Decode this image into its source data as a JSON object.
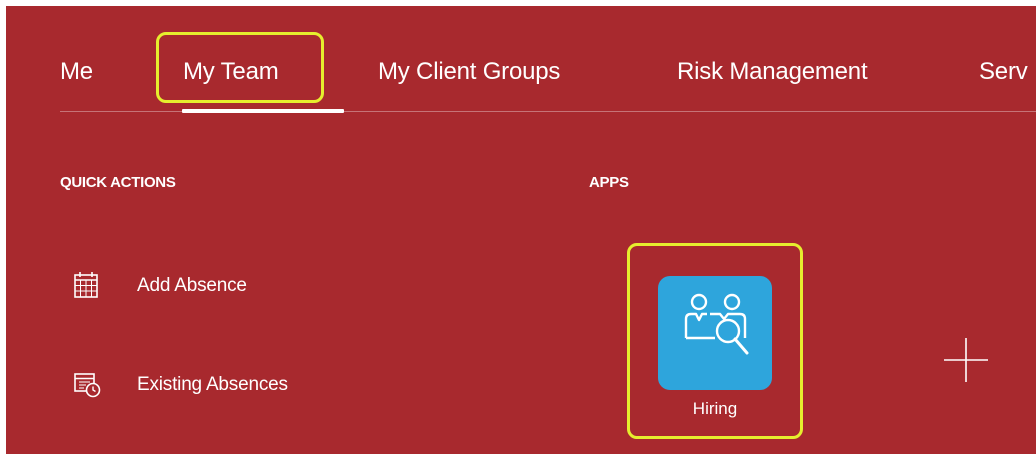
{
  "nav": {
    "tabs": [
      {
        "label": "Me"
      },
      {
        "label": "My Team"
      },
      {
        "label": "My Client Groups"
      },
      {
        "label": "Risk Management"
      },
      {
        "label": "Serv"
      }
    ],
    "active_tab": "My Team"
  },
  "quick_actions": {
    "title": "QUICK ACTIONS",
    "items": [
      {
        "label": "Add Absence",
        "icon": "calendar-icon"
      },
      {
        "label": "Existing Absences",
        "icon": "calendar-clock-icon"
      }
    ]
  },
  "apps": {
    "title": "APPS",
    "items": [
      {
        "label": "Hiring",
        "icon": "hiring-people-search-icon",
        "tile_color": "#2ea5dc"
      }
    ],
    "add_icon": "plus-icon"
  },
  "colors": {
    "background": "#a8292e",
    "highlight": "#e6ee2e",
    "app_tile": "#2ea5dc",
    "text": "#ffffff"
  }
}
